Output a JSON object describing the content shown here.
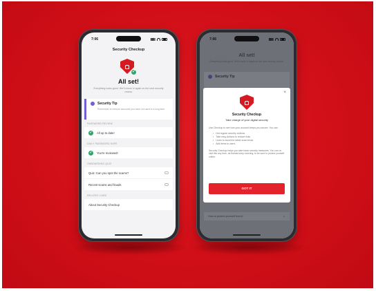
{
  "phone_left": {
    "status_time": "7:06",
    "header_title": "Security Checkup",
    "heading": "All set!",
    "subtext": "Everything looks good. We'll check in again on the next security review.",
    "tip": {
      "title": "Security Tip",
      "text": "Remember to remove accounts you have not used in a long time."
    },
    "sections": [
      {
        "label": "PASSWORD REVIEW",
        "row_text": "All up to date!"
      },
      {
        "label": "DAILY PASSWORD SAFE",
        "row_text": "You're reviewed!"
      },
      {
        "label": "ONBOARDING QUIZ"
      }
    ],
    "quiz_rows": [
      "Quiz: Can you spot the scams?",
      "Recent scams and frauds"
    ],
    "footer_label": "RELATED CARD",
    "footer_row": "About Security Checkup"
  },
  "phone_right": {
    "status_time": "7:06",
    "bg_title": "All set!",
    "bg_text": "Everything looks good. We'll check in again on the next security review.",
    "bg_tip_title": "Security Tip",
    "bg_bottom_row": "How to protect yourself from it",
    "modal": {
      "close_label": "×",
      "title": "Security Checkup",
      "subtitle": "Take charge of your digital security",
      "body": "Use Checkup to see how your account keeps you secure. You can:",
      "bullets": [
        "Get regular security reviews",
        "Take easy actions to reduce risks",
        "Learn to avoid the latest scam tricks",
        "Add items to users"
      ],
      "note": "Security Checkup helps you take basic security measures. You can re-visit this any time, as threats keep evolving, to be sure to protect yourself online.",
      "button_label": "GOT IT"
    }
  },
  "colors": {
    "brand_red": "#e4222b",
    "success_green": "#2fa568",
    "tip_purple": "#6f5ed6"
  }
}
